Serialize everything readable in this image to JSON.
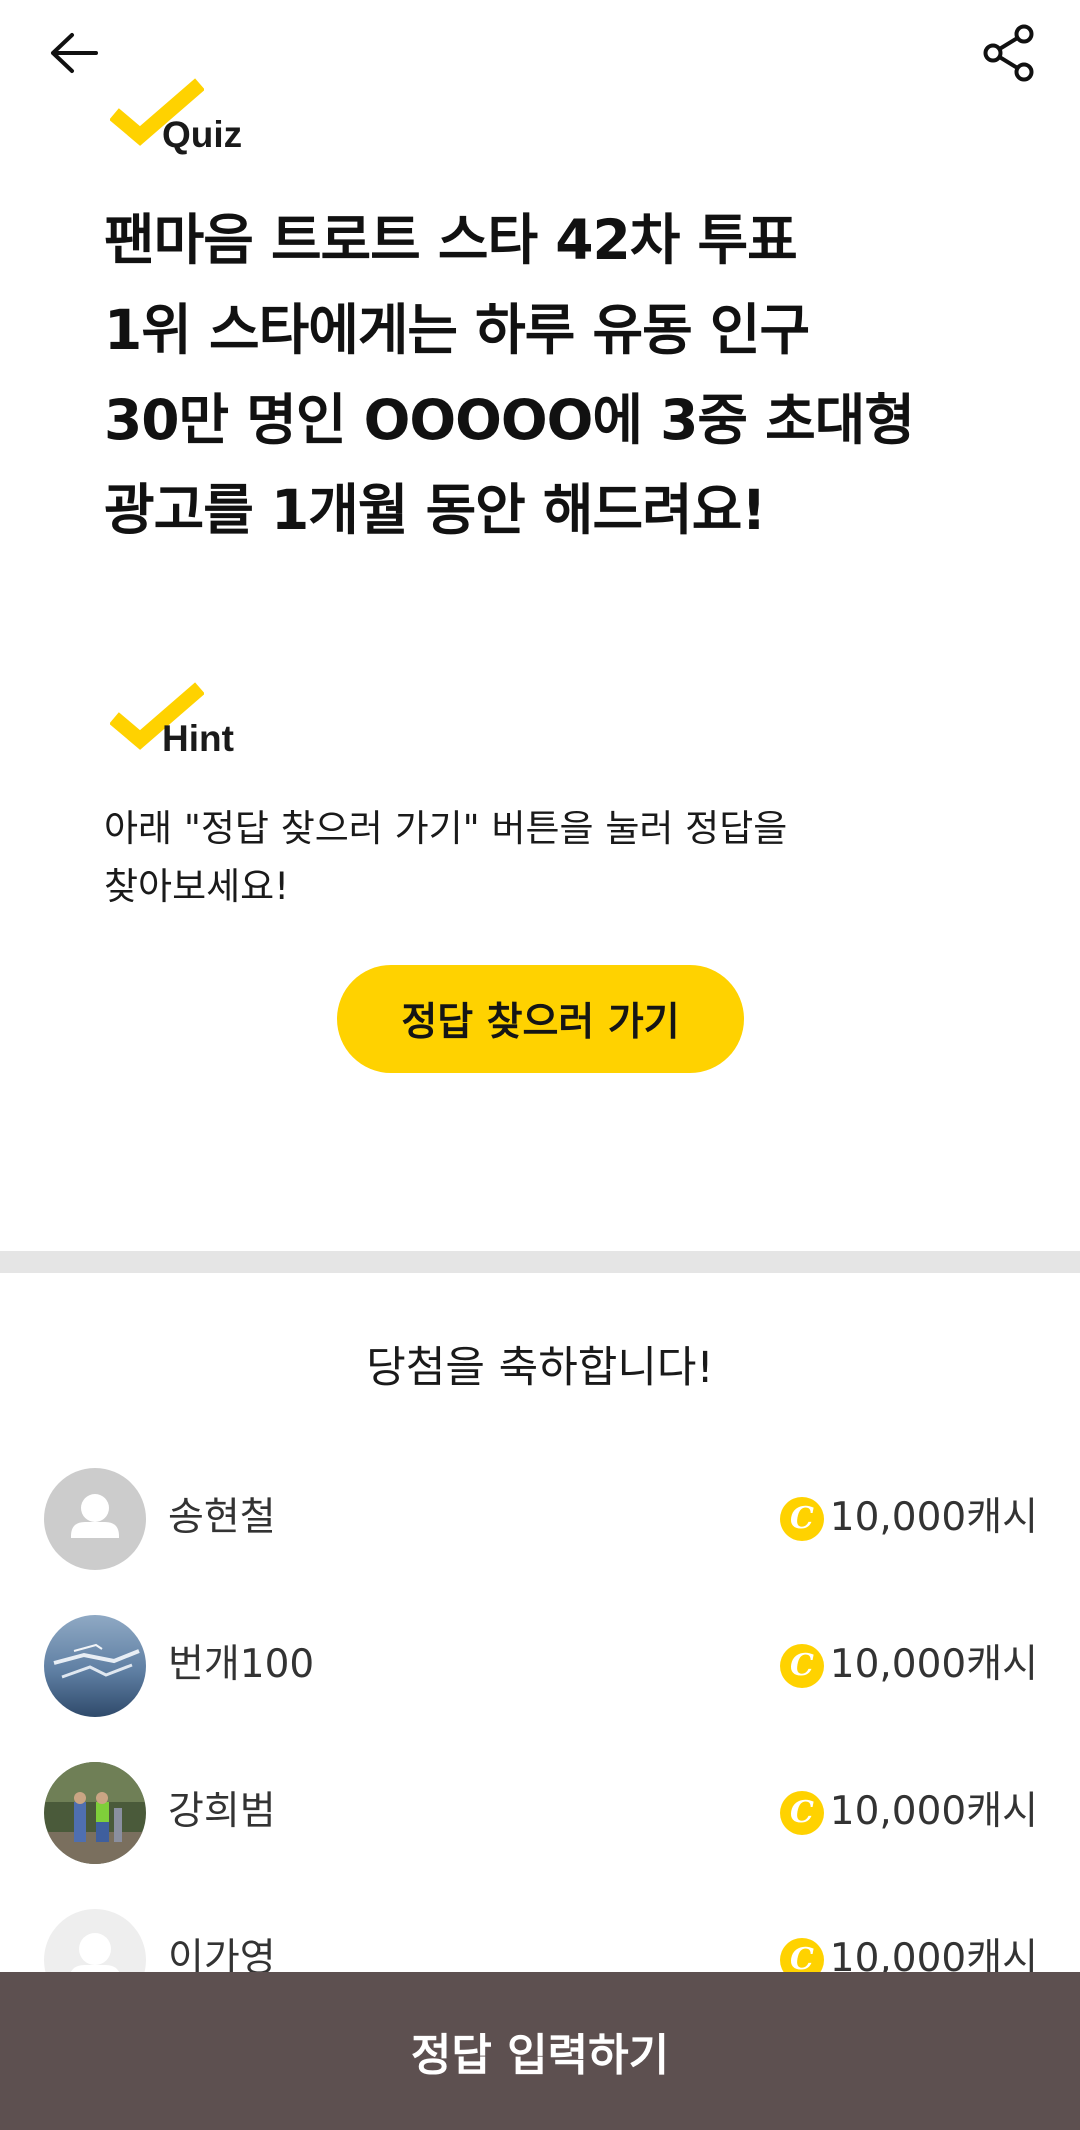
{
  "icons": {
    "back": "arrow-left-icon",
    "share": "share-icon",
    "badge_check": "checkmark-icon",
    "coin": "cash-coin-icon"
  },
  "colors": {
    "accent": "#ffd200",
    "bottom_bar": "#5d5050",
    "divider": "#e5e5e5"
  },
  "quiz": {
    "badge_label": "Quiz",
    "question_lines": [
      "팬마음 트로트 스타 42차 투표",
      "1위 스타에게는 하루 유동 인구",
      "30만 명인 OOOOO에 3중 초대형",
      "광고를 1개월 동안 해드려요!"
    ]
  },
  "hint": {
    "badge_label": "Hint",
    "text_lines": [
      "아래 \"정답 찾으러 가기\" 버튼을 눌러 정답을",
      "찾아보세요!"
    ],
    "button_label": "정답 찾으러 가기"
  },
  "winners": {
    "title": "당첨을 축하합니다!",
    "coin_symbol": "C",
    "items": [
      {
        "name": "송현철",
        "prize": "10,000캐시",
        "avatar": "default-avatar"
      },
      {
        "name": "번개100",
        "prize": "10,000캐시",
        "avatar": "photo-sky"
      },
      {
        "name": "강희범",
        "prize": "10,000캐시",
        "avatar": "photo-hikers"
      },
      {
        "name": "이가영",
        "prize": "10,000캐시",
        "avatar": "default-avatar"
      }
    ]
  },
  "bottom_bar": {
    "label": "정답 입력하기"
  }
}
